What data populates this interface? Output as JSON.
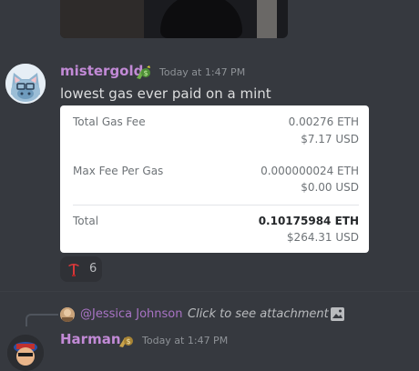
{
  "messages": [
    {
      "author": "mistergold",
      "timestamp": "Today at 1:47 PM",
      "text": "lowest gas ever paid on a mint",
      "avatar_icon": "cat-face-icon",
      "badge_icon": "money-bag-icon",
      "fee_card": {
        "rows": [
          {
            "label": "Total Gas Fee",
            "value": "0.00276 ETH",
            "sub": "$7.17 USD"
          },
          {
            "label": "Max Fee Per Gas",
            "value": "0.000000024 ETH",
            "sub": "$0.00 USD"
          },
          {
            "label": "Total",
            "value": "0.10175984 ETH",
            "sub": "$264.31 USD"
          }
        ]
      },
      "reaction": {
        "icon": "pickaxe-icon",
        "count": "6"
      }
    },
    {
      "author": "Harman",
      "timestamp": "Today at 1:47 PM",
      "badge_icon": "money-bag-icon",
      "reply": {
        "mention": "@Jessica Johnson",
        "text": "Click to see attachment",
        "icon": "image-icon"
      }
    }
  ],
  "colors": {
    "background": "#36393f",
    "username": "#c28ad6",
    "mention": "#a873c4",
    "timestamp": "#8e9297"
  }
}
